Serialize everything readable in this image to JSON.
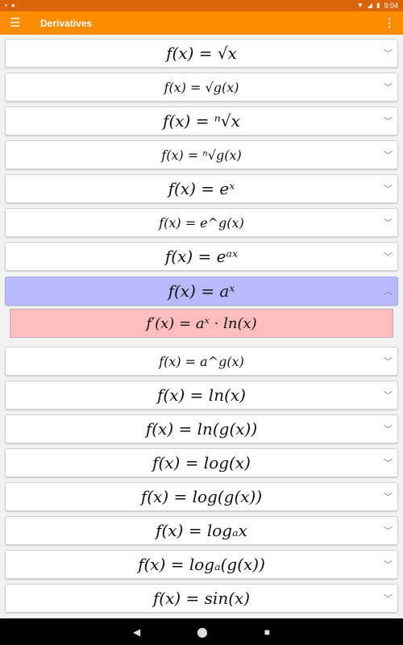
{
  "status_bar": {
    "left_icons": [
      "sd-card-icon",
      "circle-icon"
    ],
    "time": "9:04",
    "right_icons": [
      "wifi-icon",
      "signal-icon",
      "battery-icon"
    ]
  },
  "app_bar": {
    "title": "Derivatives"
  },
  "items": [
    {
      "formula": "f(x) = √x",
      "expanded": false
    },
    {
      "formula": "f(x) = √g(x)",
      "expanded": false
    },
    {
      "formula": "f(x) = ⁿ√x",
      "expanded": false
    },
    {
      "formula": "f(x) = ⁿ√g(x)",
      "expanded": false
    },
    {
      "formula": "f(x) = eˣ",
      "expanded": false
    },
    {
      "formula": "f(x) = e^g(x)",
      "expanded": false
    },
    {
      "formula": "f(x) = eᵃˣ",
      "expanded": false
    },
    {
      "formula": "f(x) = aˣ",
      "expanded": true,
      "derivative": "f′(x) = aˣ · ln(x)"
    },
    {
      "formula": "f(x) = a^g(x)",
      "expanded": false
    },
    {
      "formula": "f(x) = ln(x)",
      "expanded": false
    },
    {
      "formula": "f(x) = ln(g(x))",
      "expanded": false
    },
    {
      "formula": "f(x) = log(x)",
      "expanded": false
    },
    {
      "formula": "f(x) = log(g(x))",
      "expanded": false
    },
    {
      "formula": "f(x) = logₐx",
      "expanded": false
    },
    {
      "formula": "f(x) = logₐ(g(x))",
      "expanded": false
    },
    {
      "formula": "f(x) = sin(x)",
      "expanded": false
    }
  ],
  "colors": {
    "status_bar": "#d9640a",
    "app_bar": "#fb8c00",
    "selected_row": "#b9b9ff",
    "derivative_box": "#ffbdbd"
  }
}
